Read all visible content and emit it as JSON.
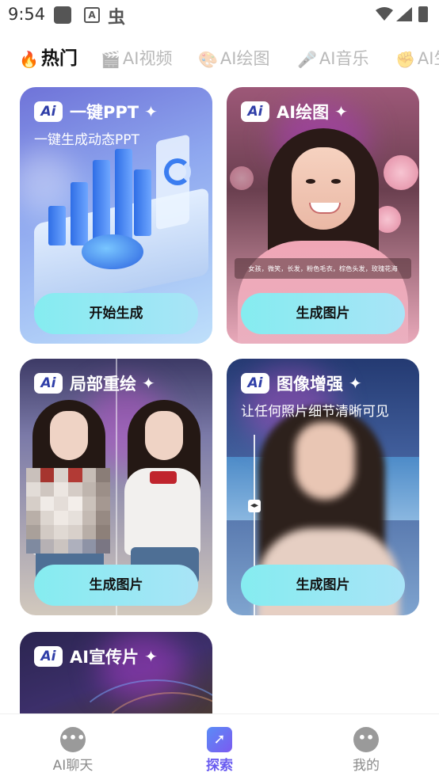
{
  "status_bar": {
    "time": "9:54",
    "notif_icon_letter": "A"
  },
  "tabs": [
    {
      "icon": "fire-icon",
      "glyph": "🔥",
      "label": "热门",
      "active": true
    },
    {
      "icon": "clapperboard-icon",
      "glyph": "🎬",
      "label": "AI视频",
      "active": false
    },
    {
      "icon": "palette-icon",
      "glyph": "🎨",
      "label": "AI绘图",
      "active": false
    },
    {
      "icon": "microphone-icon",
      "glyph": "🎤",
      "label": "AI音乐",
      "active": false
    },
    {
      "icon": "hand-icon",
      "glyph": "✊",
      "label": "AI生",
      "active": false
    }
  ],
  "cards": [
    {
      "badge": "Ai",
      "title": "一键PPT",
      "subtitle": "一键生成动态PPT",
      "button": "开始生成"
    },
    {
      "badge": "Ai",
      "title": "AI绘图",
      "prompt": "女孩，微笑，长发，粉色毛衣，棕色头发，玫瑰花海",
      "button": "生成图片"
    },
    {
      "badge": "Ai",
      "title": "局部重绘",
      "button": "生成图片"
    },
    {
      "badge": "Ai",
      "title": "图像增强",
      "subtitle": "让任何照片细节清晰可见",
      "button": "生成图片"
    },
    {
      "badge": "Ai",
      "title": "AI宣传片"
    }
  ],
  "bottom_nav": [
    {
      "icon": "chat-bubble-icon",
      "label": "AI聊天",
      "active": false
    },
    {
      "icon": "compass-icon",
      "label": "探索",
      "active": true
    },
    {
      "icon": "profile-icon",
      "label": "我的",
      "active": false
    }
  ],
  "colors": {
    "accent": "#6a5cf0",
    "button_start": "#85ecf0",
    "button_end": "#a9e4f7"
  }
}
